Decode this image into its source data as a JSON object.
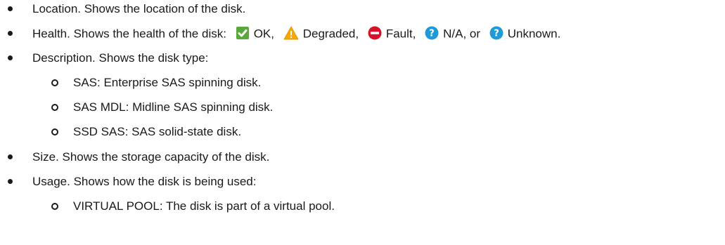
{
  "items": {
    "location": "Location. Shows the location of the disk.",
    "health": {
      "prefix": "Health. Shows the health of the disk:",
      "ok": "OK,",
      "degraded": "Degraded,",
      "fault": "Fault,",
      "na": "N/A, or",
      "unknown": "Unknown."
    },
    "description": "Description. Shows the disk type:",
    "description_sub": [
      "SAS: Enterprise SAS spinning disk.",
      "SAS MDL: Midline SAS spinning disk.",
      "SSD SAS: SAS solid-state disk."
    ],
    "size": "Size. Shows the storage capacity of the disk.",
    "usage": "Usage. Shows how the disk is being used:",
    "usage_sub": [
      "VIRTUAL POOL: The disk is part of a virtual pool."
    ]
  },
  "icons": {
    "ok": "check-icon",
    "degraded": "warning-icon",
    "fault": "fault-icon",
    "na": "question-icon",
    "unknown": "question-icon"
  },
  "colors": {
    "ok": "#5aa83a",
    "degraded": "#f5a800",
    "fault": "#d7122b",
    "question": "#1f9ad6"
  }
}
